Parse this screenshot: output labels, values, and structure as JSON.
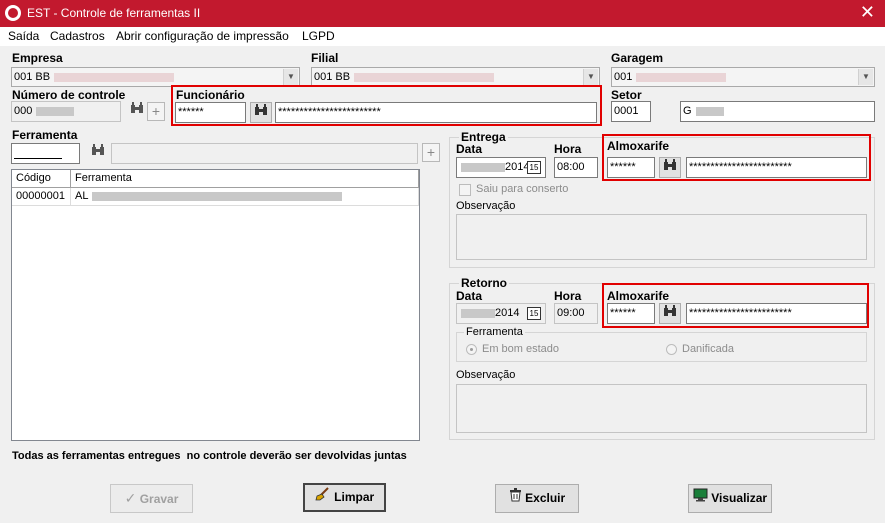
{
  "window": {
    "title": "EST - Controle de ferramentas II"
  },
  "menu": [
    "Saída",
    "Cadastros",
    "Abrir configuração de impressão",
    "LGPD"
  ],
  "empresa": {
    "label": "Empresa",
    "value": "001 BB"
  },
  "filial": {
    "label": "Filial",
    "value": "001 BB"
  },
  "garagem": {
    "label": "Garagem",
    "value": "001"
  },
  "controle": {
    "label": "Número de controle",
    "value": "000"
  },
  "funcionario": {
    "label": "Funcionário",
    "code": "******",
    "name": "************************"
  },
  "setor": {
    "label": "Setor",
    "code": "0001",
    "name": "G"
  },
  "ferramenta": {
    "label": "Ferramenta",
    "value": ""
  },
  "grid": {
    "columns": [
      "Código",
      "Ferramenta"
    ],
    "rows": [
      {
        "codigo": "00000001",
        "ferramenta": "AL"
      }
    ]
  },
  "entrega": {
    "title": "Entrega",
    "data_label": "Data",
    "data_value": "2014",
    "hora_label": "Hora",
    "hora_value": "08:00",
    "almoxarife_label": "Almoxarife",
    "almoxarife_code": "******",
    "almoxarife_name": "************************",
    "conserto_label": "Saiu para conserto",
    "obs_label": "Observação"
  },
  "retorno": {
    "title": "Retorno",
    "data_label": "Data",
    "data_value": "2014",
    "hora_label": "Hora",
    "hora_value": "09:00",
    "almoxarife_label": "Almoxarife",
    "almoxarife_code": "******",
    "almoxarife_name": "************************",
    "ferramenta_group": "Ferramenta",
    "bom_estado": "Em bom estado",
    "danificada": "Danificada",
    "obs_label": "Observação"
  },
  "note": "Todas as ferramentas entregues  no controle deverão ser devolvidas juntas",
  "buttons": {
    "gravar": "Gravar",
    "limpar": "Limpar",
    "excluir": "Excluir",
    "visualizar": "Visualizar"
  },
  "icons": {
    "app": "app-logo-icon",
    "close": "close-icon",
    "search": "binoculars-icon",
    "add": "plus-icon",
    "calendar": "calendar-icon",
    "gravar": "checkmark-icon",
    "limpar": "broom-icon",
    "excluir": "trash-icon",
    "visualizar": "monitor-icon"
  },
  "colors": {
    "titlebar": "#c2192e",
    "highlight_box": "#e10000"
  }
}
